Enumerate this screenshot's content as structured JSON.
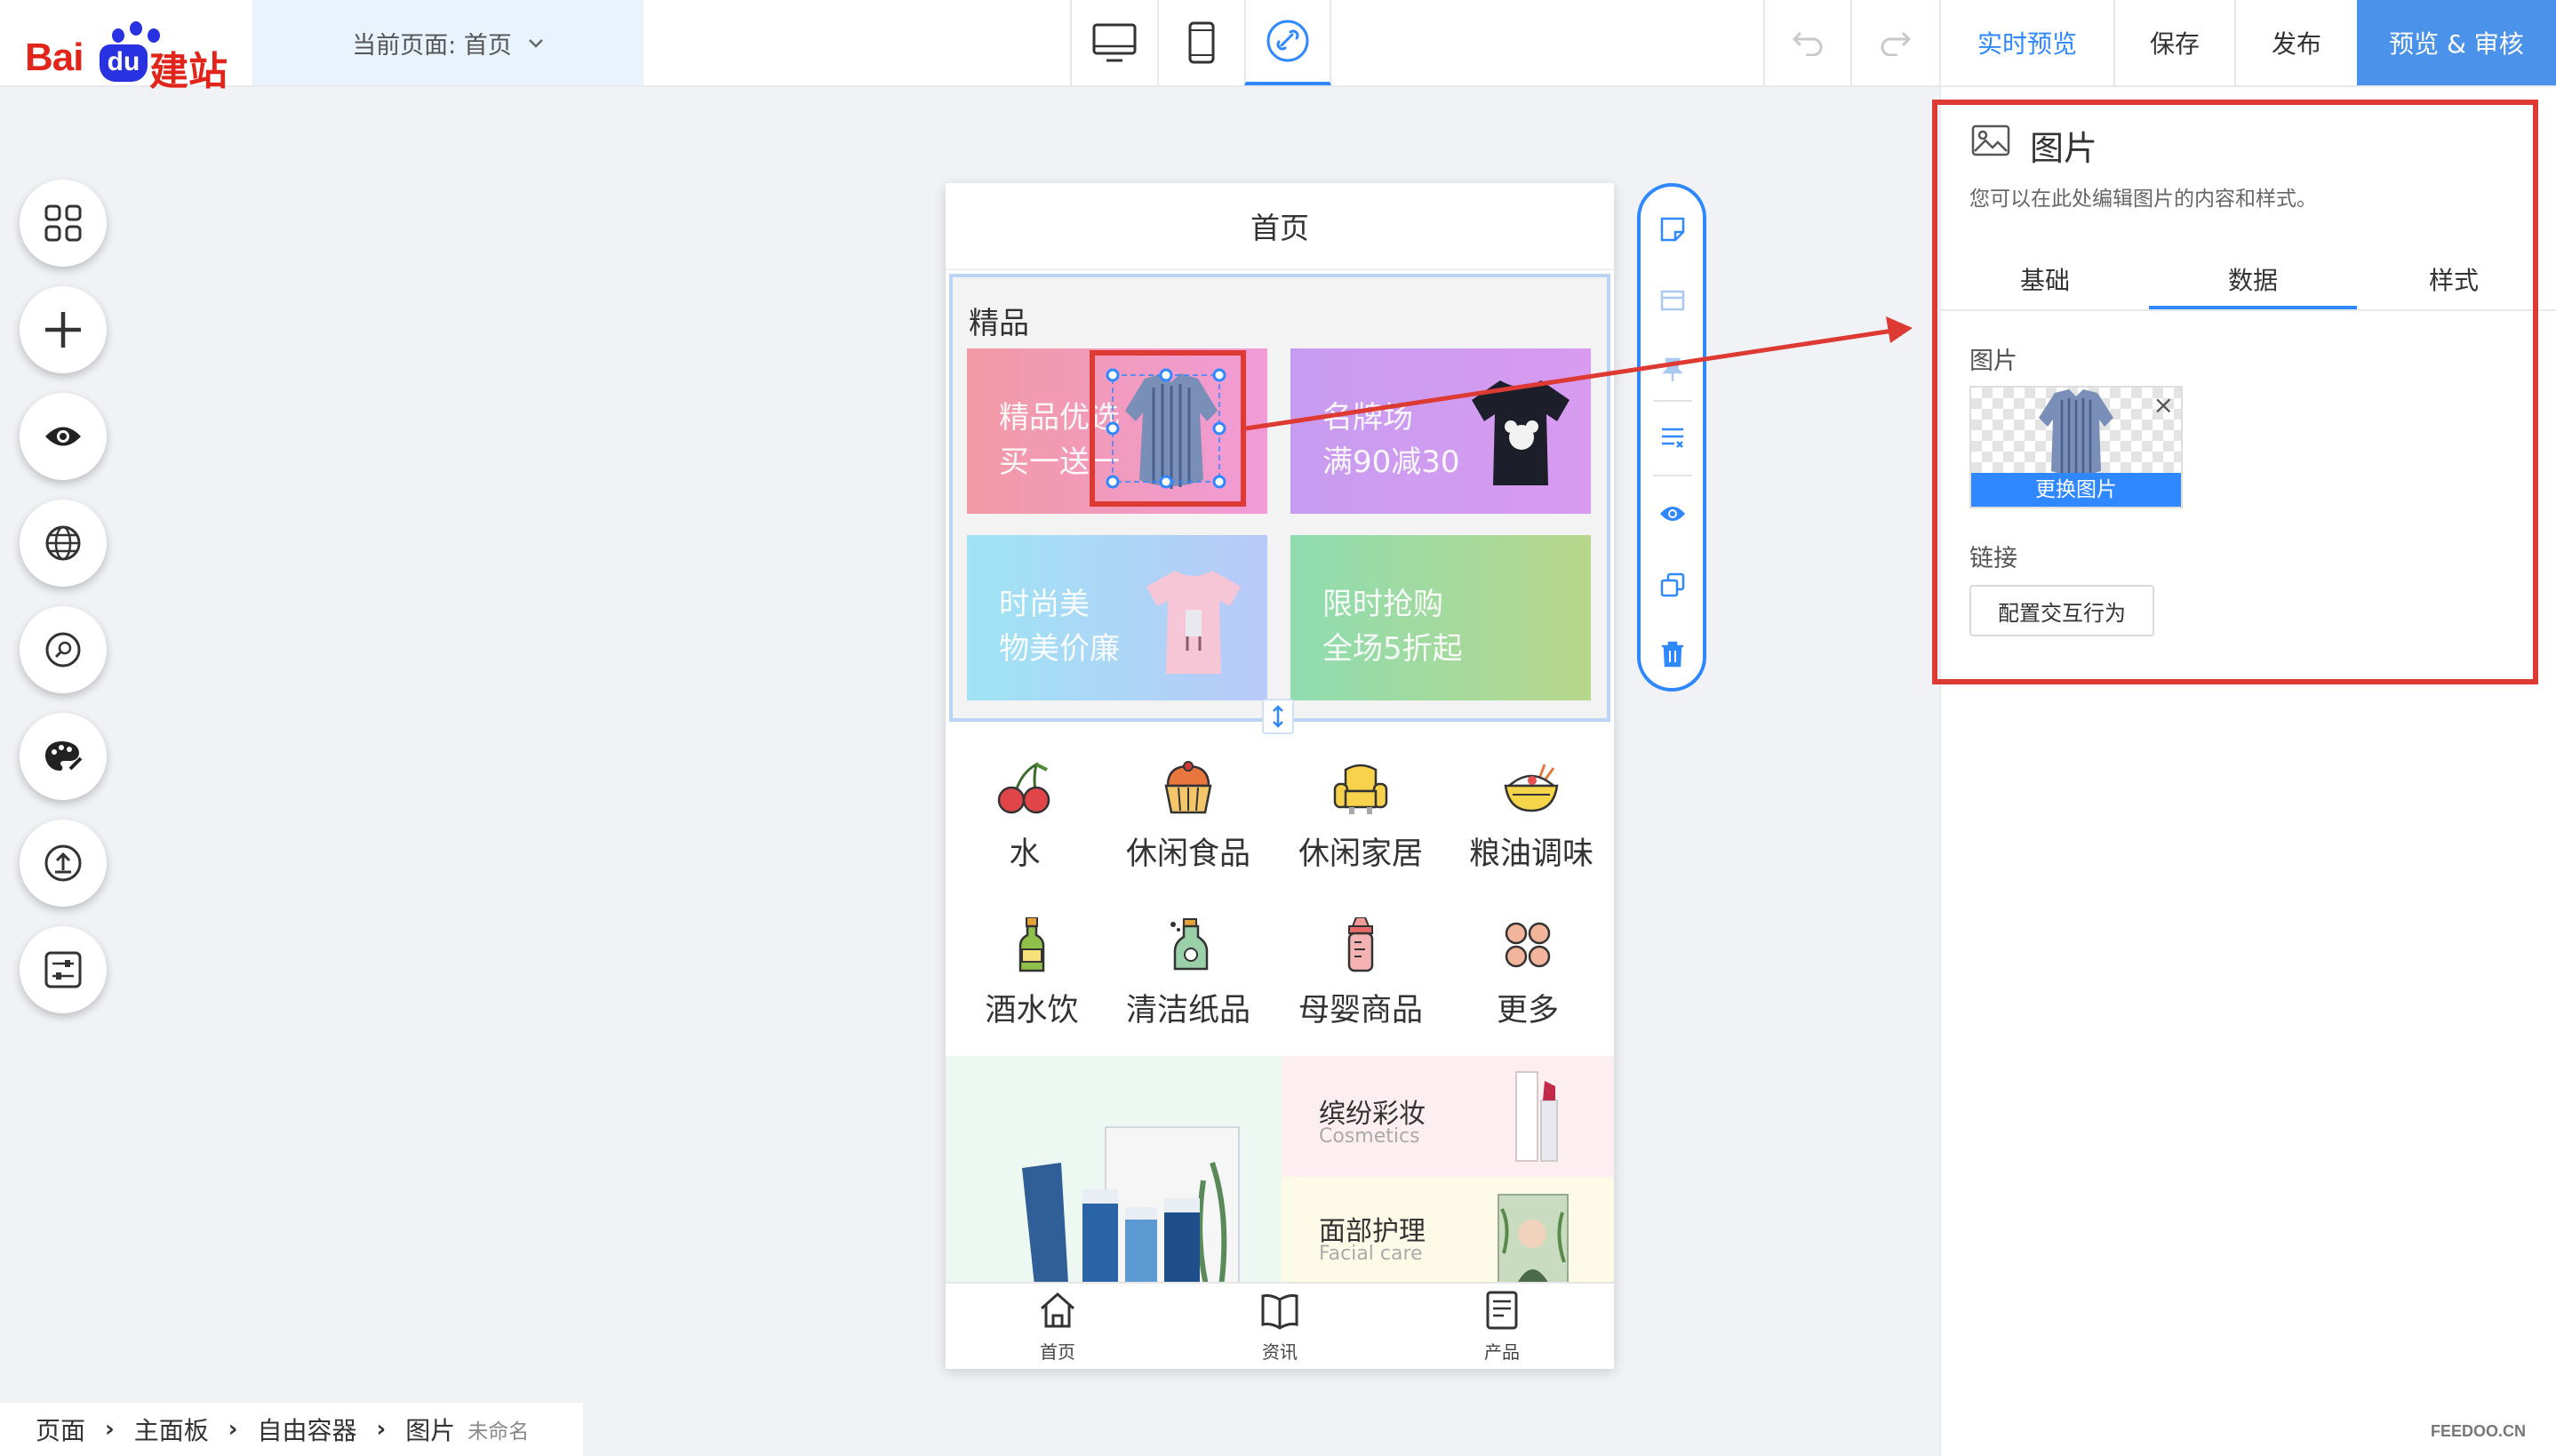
{
  "header": {
    "logo_text_bai": "Bai",
    "logo_text_du": "du",
    "logo_text_jz": "建站",
    "current_page_label": "当前页面: 首页",
    "devices": [
      "desktop",
      "mobile",
      "link"
    ],
    "actions": {
      "live_preview": "实时预览",
      "save": "保存",
      "publish": "发布",
      "preview_review": "预览 & 审核"
    }
  },
  "left_tools": [
    "grid-icon",
    "plus-icon",
    "eye-icon",
    "globe-icon",
    "search-icon",
    "palette-icon",
    "upload-icon",
    "sliders-icon"
  ],
  "phone": {
    "title": "首页",
    "section_title": "精品",
    "tiles": [
      {
        "line1": "精品优选",
        "line2": "买一送一"
      },
      {
        "line1": "名牌场",
        "line2": "满90减30"
      },
      {
        "line1": "时尚美",
        "line2": "物美价廉"
      },
      {
        "line1": "限时抢购",
        "line2": "全场5折起"
      }
    ],
    "categories": [
      "水",
      "休闲食品",
      "休闲家居",
      "粮油调味",
      "酒水饮",
      "清洁纸品",
      "母婴商品",
      "更多"
    ],
    "promos": [
      {
        "title": "缤纷彩妆",
        "subtitle": "Cosmetics"
      },
      {
        "title": "面部护理",
        "subtitle": "Facial care"
      }
    ],
    "tabbar": [
      "首页",
      "资讯",
      "产品"
    ]
  },
  "panel": {
    "title": "图片",
    "description": "您可以在此处编辑图片的内容和样式。",
    "tabs": [
      "基础",
      "数据",
      "样式"
    ],
    "image_label": "图片",
    "replace_image": "更换图片",
    "link_label": "链接",
    "config_button": "配置交互行为"
  },
  "breadcrumb": {
    "items": [
      "页面",
      "主面板",
      "自由容器",
      "图片"
    ],
    "unnamed": "未命名"
  },
  "watermark": "FEEDOO.CN",
  "colors": {
    "accent": "#2f88ff",
    "annotation": "#dd3a34",
    "brand_red": "#e1251b",
    "brand_blue": "#2932e1"
  }
}
